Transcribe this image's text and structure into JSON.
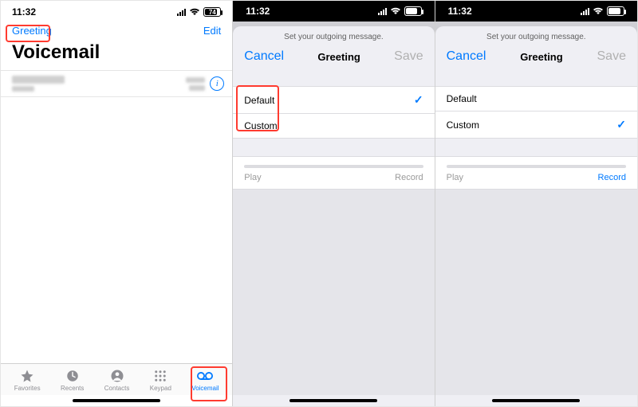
{
  "status": {
    "time": "11:32",
    "battery": "74"
  },
  "screen1": {
    "greeting_link": "Greeting",
    "edit_link": "Edit",
    "title": "Voicemail",
    "tabs": {
      "favorites": "Favorites",
      "recents": "Recents",
      "contacts": "Contacts",
      "keypad": "Keypad",
      "voicemail": "Voicemail"
    }
  },
  "sheet": {
    "hint": "Set your outgoing message.",
    "cancel": "Cancel",
    "title": "Greeting",
    "save": "Save",
    "option_default": "Default",
    "option_custom": "Custom",
    "play": "Play",
    "record": "Record"
  }
}
